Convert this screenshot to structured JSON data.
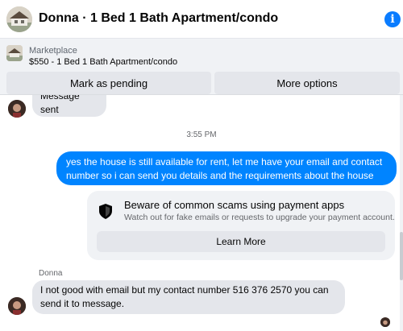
{
  "header": {
    "title": "Donna · 1 Bed 1 Bath Apartment/condo",
    "info_icon": "info-icon",
    "info_glyph": "i"
  },
  "marketplace": {
    "label": "Marketplace",
    "item": "$550 - 1 Bed 1 Bath Apartment/condo"
  },
  "actions": {
    "mark_pending": "Mark as pending",
    "more_options": "More options"
  },
  "messages": [
    {
      "from": "Donna",
      "text": "Message sent",
      "clipped": true
    },
    {
      "from": "me",
      "text": "yes the house is still available for rent, let me have your email  and contact number so i can send you details and the requirements about the house"
    },
    {
      "from": "Donna",
      "text": "I not good with email but my contact number 516 376 2570  you can send it to message."
    }
  ],
  "timestamp": "3:55 PM",
  "scam_warning": {
    "icon": "shield-icon",
    "title": "Beware of common scams using payment apps",
    "subtitle": "Watch out for fake emails or requests to upgrade your payment account.",
    "button": "Learn More"
  },
  "sender_label": "Donna",
  "colors": {
    "accent": "#0084ff",
    "info": "#0a7cff",
    "incoming_bubble": "#e4e6eb",
    "panel": "#f0f2f5",
    "muted_text": "#65676b"
  }
}
